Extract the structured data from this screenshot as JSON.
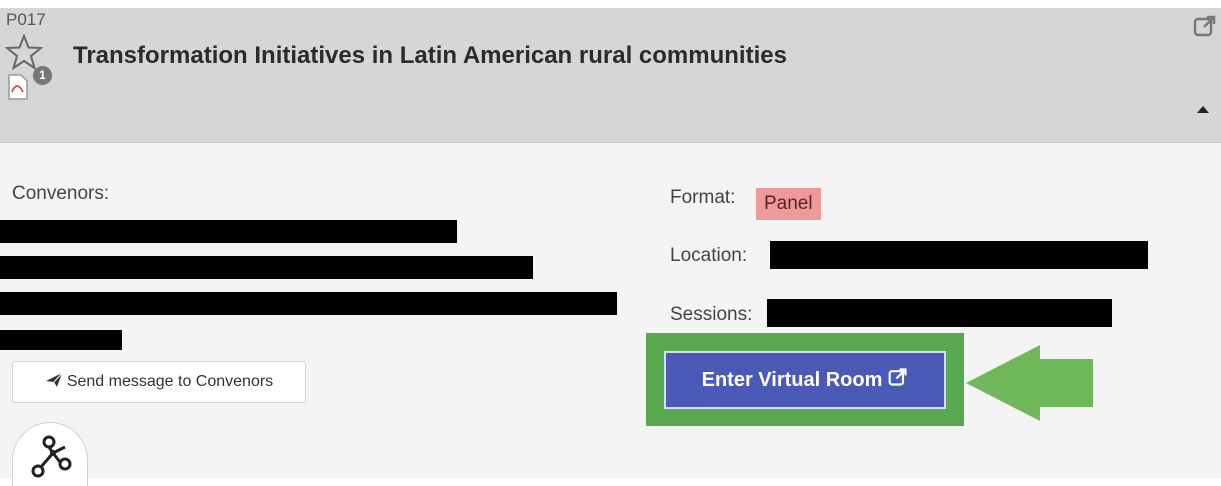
{
  "header": {
    "panel_code": "P017",
    "badge_count": "1",
    "title": "Transformation Initiatives in Latin American rural communities"
  },
  "convenors": {
    "label": "Convenors:",
    "send_button_label": "Send message to Convenors"
  },
  "details": {
    "format_label": "Format:",
    "format_value": "Panel",
    "location_label": "Location:",
    "sessions_label": "Sessions:"
  },
  "virtual_room": {
    "button_label": "Enter Virtual Room"
  },
  "colors": {
    "header_bg": "#d6d6d6",
    "format_badge": "#ef9a9a",
    "room_button": "#4c5ab7",
    "highlight_green": "#58a84f"
  },
  "icons": [
    "star-icon",
    "pdf-icon",
    "external-link-icon",
    "collapse-icon",
    "send-icon",
    "network-graph-icon",
    "green-arrow-annotation"
  ]
}
